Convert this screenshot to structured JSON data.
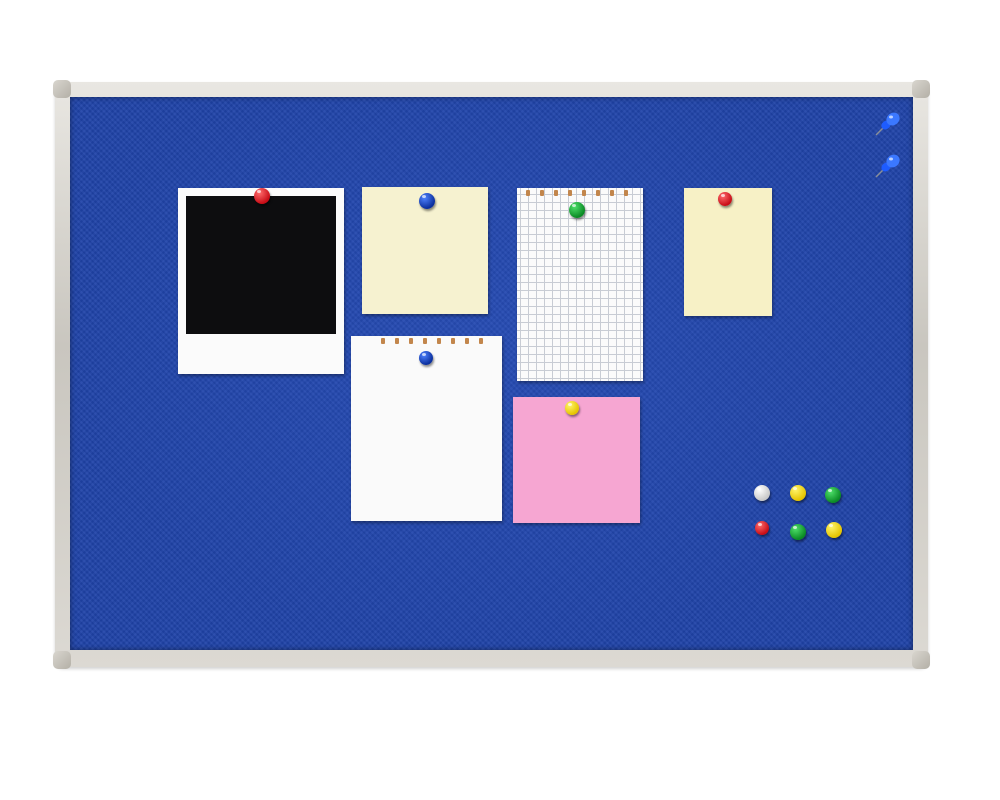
{
  "scene": {
    "subject": "cork-board",
    "felt_color": "#1f43a8",
    "frame_color": "#d2cfc8"
  },
  "papers": [
    {
      "name": "polaroid-photo",
      "color": "#fbfbfb",
      "inner_color": "#0d0d0f",
      "pin_color": "red"
    },
    {
      "name": "cream-note",
      "color": "#f6f2d0",
      "pin_color": "blue"
    },
    {
      "name": "grid-notepad-page",
      "color": "#fbfbfb",
      "pin_color": "green"
    },
    {
      "name": "small-cream-note",
      "color": "#f7f1c6",
      "pin_color": "red"
    },
    {
      "name": "white-notepad-page",
      "color": "#fafafa",
      "pin_color": "blue"
    },
    {
      "name": "pink-sticky-note",
      "color": "#f6a6d2",
      "pin_color": "yellow"
    }
  ],
  "loose_pins": [
    "white",
    "yellow",
    "green",
    "red",
    "green",
    "yellow"
  ],
  "pushpins": [
    "blue-pushpin",
    "blue-pushpin"
  ]
}
